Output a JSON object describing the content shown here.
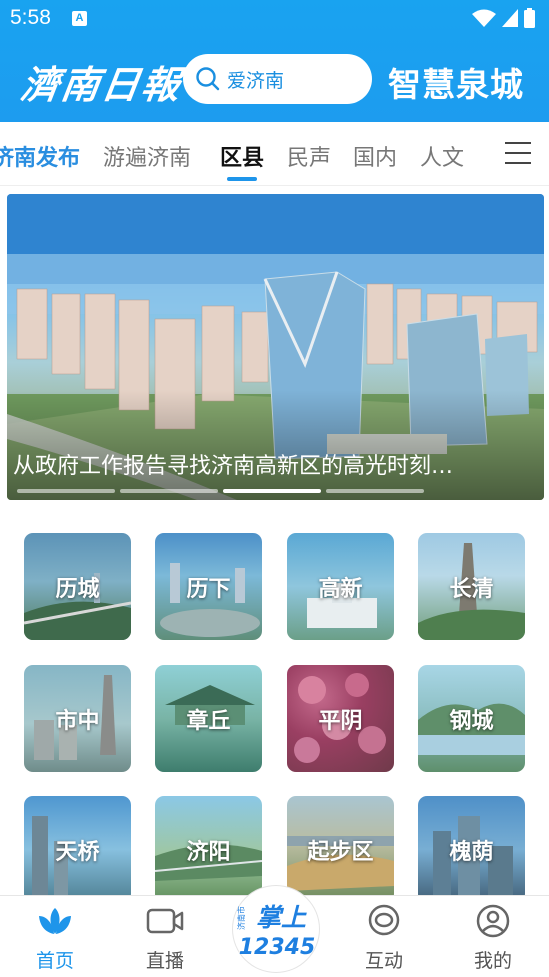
{
  "status_bar": {
    "time": "5:58",
    "notification_glyph": "A"
  },
  "header": {
    "logo_left": "濟南日報",
    "search_placeholder": "爱济南",
    "logo_right": "智慧泉城"
  },
  "tabs": {
    "items": [
      {
        "label": "济南发布"
      },
      {
        "label": "游遍济南"
      },
      {
        "label": "区县"
      },
      {
        "label": "民声"
      },
      {
        "label": "国内"
      },
      {
        "label": "人文"
      }
    ],
    "active_index": 2
  },
  "banner": {
    "caption": "从政府工作报告寻找济南高新区的高光时刻…",
    "slide_count": 4,
    "active_slide": 3
  },
  "districts": [
    {
      "label": "历城"
    },
    {
      "label": "历下"
    },
    {
      "label": "高新"
    },
    {
      "label": "长清"
    },
    {
      "label": "市中"
    },
    {
      "label": "章丘"
    },
    {
      "label": "平阴"
    },
    {
      "label": "钢城"
    },
    {
      "label": "天桥"
    },
    {
      "label": "济阳"
    },
    {
      "label": "起步区"
    },
    {
      "label": "槐荫"
    }
  ],
  "bottom_nav": {
    "items": [
      {
        "label": "首页"
      },
      {
        "label": "直播"
      },
      {
        "label": "互动"
      },
      {
        "label": "我的"
      }
    ],
    "center_badge_text": "掌上12345",
    "center_badge_small": "济南市"
  },
  "colors": {
    "brand_blue": "#1e95ea",
    "header_blue": "#19a3f0"
  }
}
